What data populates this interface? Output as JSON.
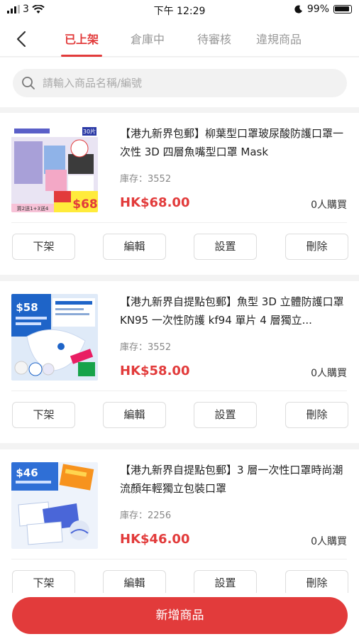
{
  "status_bar": {
    "carrier": "3",
    "time": "下午 12:29",
    "battery": "99%"
  },
  "nav": {
    "tabs": [
      {
        "label": "已上架",
        "active": true
      },
      {
        "label": "倉庫中",
        "active": false
      },
      {
        "label": "待審核",
        "active": false
      },
      {
        "label": "違規商品",
        "active": false
      }
    ]
  },
  "search": {
    "placeholder": "請輸入商品名稱/編號"
  },
  "products": [
    {
      "title": "【港九新界包郵】柳葉型口罩玻尿酸防護口罩一次性 3D 四層魚嘴型口罩 Mask",
      "stock": "庫存：3552",
      "price": "HK$68.00",
      "sold": "0人購買",
      "image": {
        "badge": "$68",
        "corner": "30片",
        "caption": "買2送1+3送4"
      }
    },
    {
      "title": "【港九新界自提點包郵】魚型 3D 立體防護口罩 KN95 一次性防護 kf94 單片 4 層獨立...",
      "stock": "庫存：3552",
      "price": "HK$58.00",
      "sold": "0人購買",
      "image": {
        "badge": "$58",
        "corner": "",
        "caption": ""
      }
    },
    {
      "title": "【港九新界自提點包郵】3 層一次性口罩時尚潮流顏年輕獨立包裝口罩",
      "stock": "庫存：2256",
      "price": "HK$46.00",
      "sold": "0人購買",
      "image": {
        "badge": "$46",
        "corner": "",
        "caption": ""
      }
    }
  ],
  "actions": {
    "unlist": "下架",
    "edit": "編輯",
    "settings": "設置",
    "delete": "刪除"
  },
  "bottom": {
    "add_label": "新增商品"
  },
  "colors": {
    "accent": "#e23b3b"
  }
}
